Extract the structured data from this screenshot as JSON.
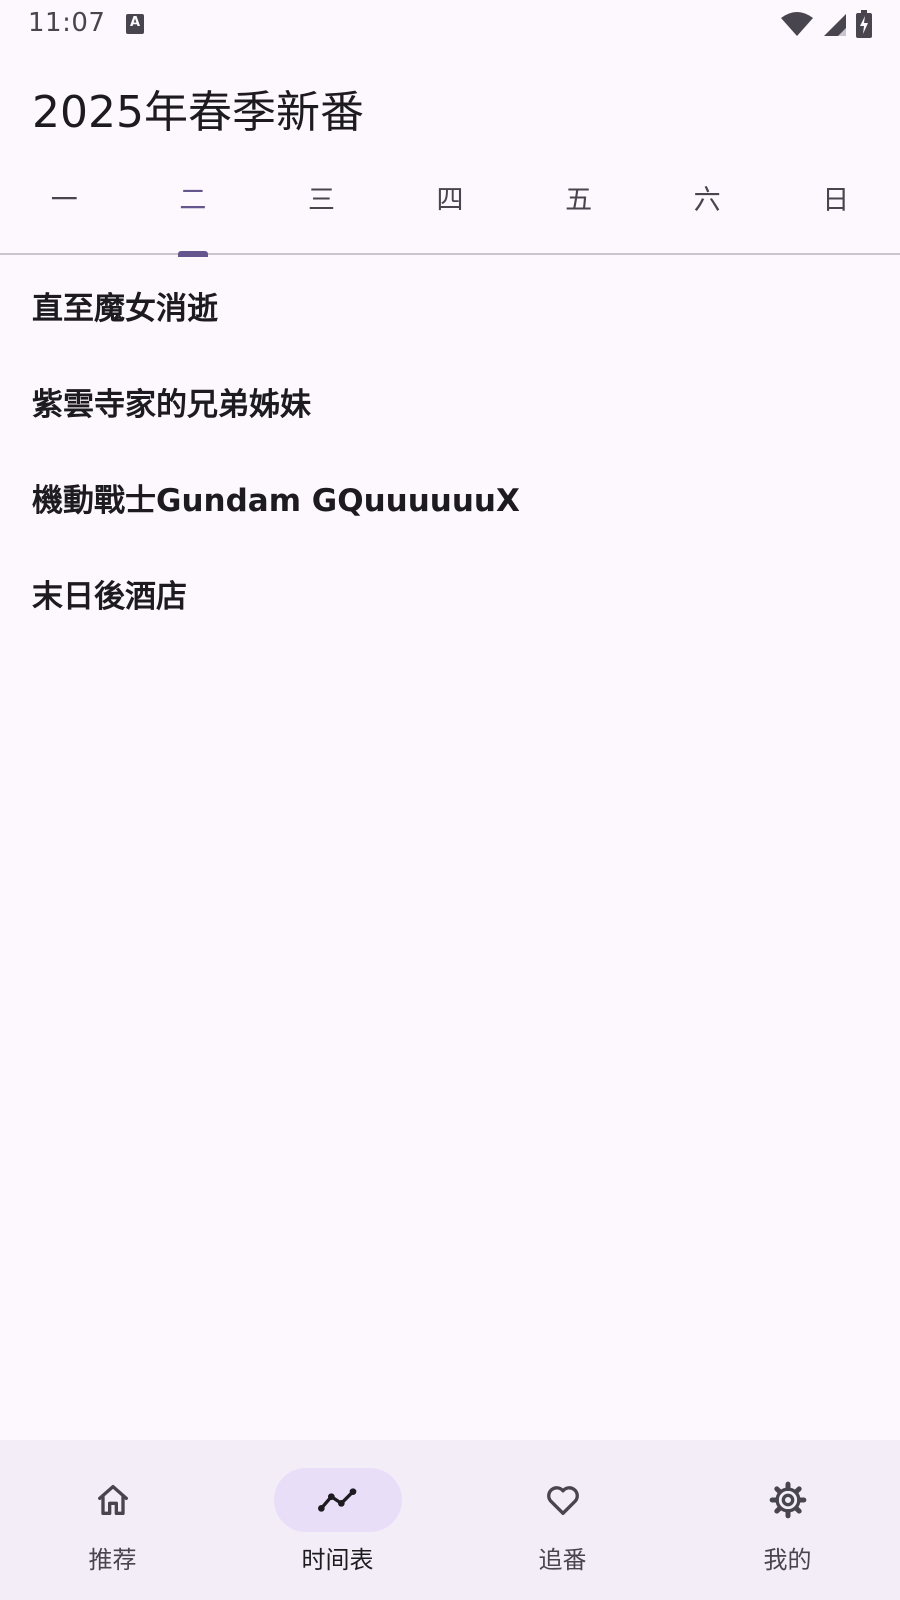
{
  "status_bar": {
    "time": "11:07",
    "notification_icon": "a-icon",
    "icons": [
      "wifi-icon",
      "signal-icon",
      "battery-icon"
    ]
  },
  "header": {
    "title": "2025年春季新番"
  },
  "tabs": [
    {
      "label": "一",
      "active": false
    },
    {
      "label": "二",
      "active": true
    },
    {
      "label": "三",
      "active": false
    },
    {
      "label": "四",
      "active": false
    },
    {
      "label": "五",
      "active": false
    },
    {
      "label": "六",
      "active": false
    },
    {
      "label": "日",
      "active": false
    }
  ],
  "anime_list": [
    {
      "title": "直至魔女消逝"
    },
    {
      "title": "紫雲寺家的兄弟姊妹"
    },
    {
      "title": "機動戰士Gundam GQuuuuuuX"
    },
    {
      "title": "末日後酒店"
    }
  ],
  "bottom_nav": [
    {
      "label": "推荐",
      "icon": "home-icon",
      "active": false
    },
    {
      "label": "时间表",
      "icon": "timeline-icon",
      "active": true
    },
    {
      "label": "追番",
      "icon": "heart-icon",
      "active": false
    },
    {
      "label": "我的",
      "icon": "gear-icon",
      "active": false
    }
  ],
  "colors": {
    "background": "#fdf7fe",
    "accent": "#65558f",
    "nav_background": "#f3edf7",
    "nav_active_pill": "#e8def8"
  }
}
